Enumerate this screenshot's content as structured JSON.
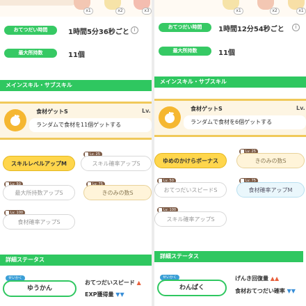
{
  "left": {
    "badges": [
      "x1",
      "x2",
      "x3"
    ],
    "help_time": {
      "label": "おてつだい時間",
      "value": "1時間5分36秒ごと",
      "info": "i"
    },
    "max_hold": {
      "label": "最大所持数",
      "value": "11個"
    },
    "skills_header": "メインスキル・サブスキル",
    "main_skill": {
      "name": "食材ゲットS",
      "lv": "Lv.",
      "desc": "ランダムで食材を11個ゲットする"
    },
    "subskills": [
      {
        "label": "スキルレベルアップM",
        "lv": ""
      },
      {
        "label": "スキル確率アップS",
        "lv": "Lv. 25"
      },
      {
        "label": "最大所持数アップS",
        "lv": "Lv. 50"
      },
      {
        "label": "きのみの数S",
        "lv": "Lv. 75"
      },
      {
        "label": "食材確率アップS",
        "lv": "Lv. 100"
      }
    ],
    "detail_header": "詳細ステータス",
    "nature_tag": "せいかく",
    "nature": "ゆうかん",
    "stats": [
      {
        "label": "おてつだいスピード",
        "arrow": "▲"
      },
      {
        "label": "EXP獲得量",
        "arrow": "▼▼"
      }
    ]
  },
  "right": {
    "badges": [
      "x1",
      "x2",
      "x1"
    ],
    "help_time": {
      "label": "おてつだい時間",
      "value": "1時間12分54秒ごと",
      "info": "i"
    },
    "max_hold": {
      "label": "最大所持数",
      "value": "11個"
    },
    "skills_header": "メインスキル・サブスキル",
    "main_skill": {
      "name": "食材ゲットS",
      "lv": "Lv.",
      "desc": "ランダムで食材を6個ゲットする"
    },
    "subskills": [
      {
        "label": "ゆめのかけらボーナス",
        "lv": ""
      },
      {
        "label": "きのみの数S",
        "lv": "Lv. 25"
      },
      {
        "label": "おてつだいスピードS",
        "lv": "Lv. 50"
      },
      {
        "label": "食材確率アップM",
        "lv": "Lv. 75"
      },
      {
        "label": "スキル確率アップS",
        "lv": "Lv. 100"
      }
    ],
    "detail_header": "詳細ステータス",
    "nature_tag": "せいかく",
    "nature": "わんぱく",
    "stats": [
      {
        "label": "げんき回復量",
        "arrow": "▲▲"
      },
      {
        "label": "食材おてつだい確率",
        "arrow": "▼▼"
      }
    ]
  },
  "colors": {
    "green": "#2fc760",
    "gold": "#ffd64c",
    "cream": "#fdf5e3",
    "up_arrow": "#e8603c",
    "down_arrow": "#3a8fd8"
  }
}
